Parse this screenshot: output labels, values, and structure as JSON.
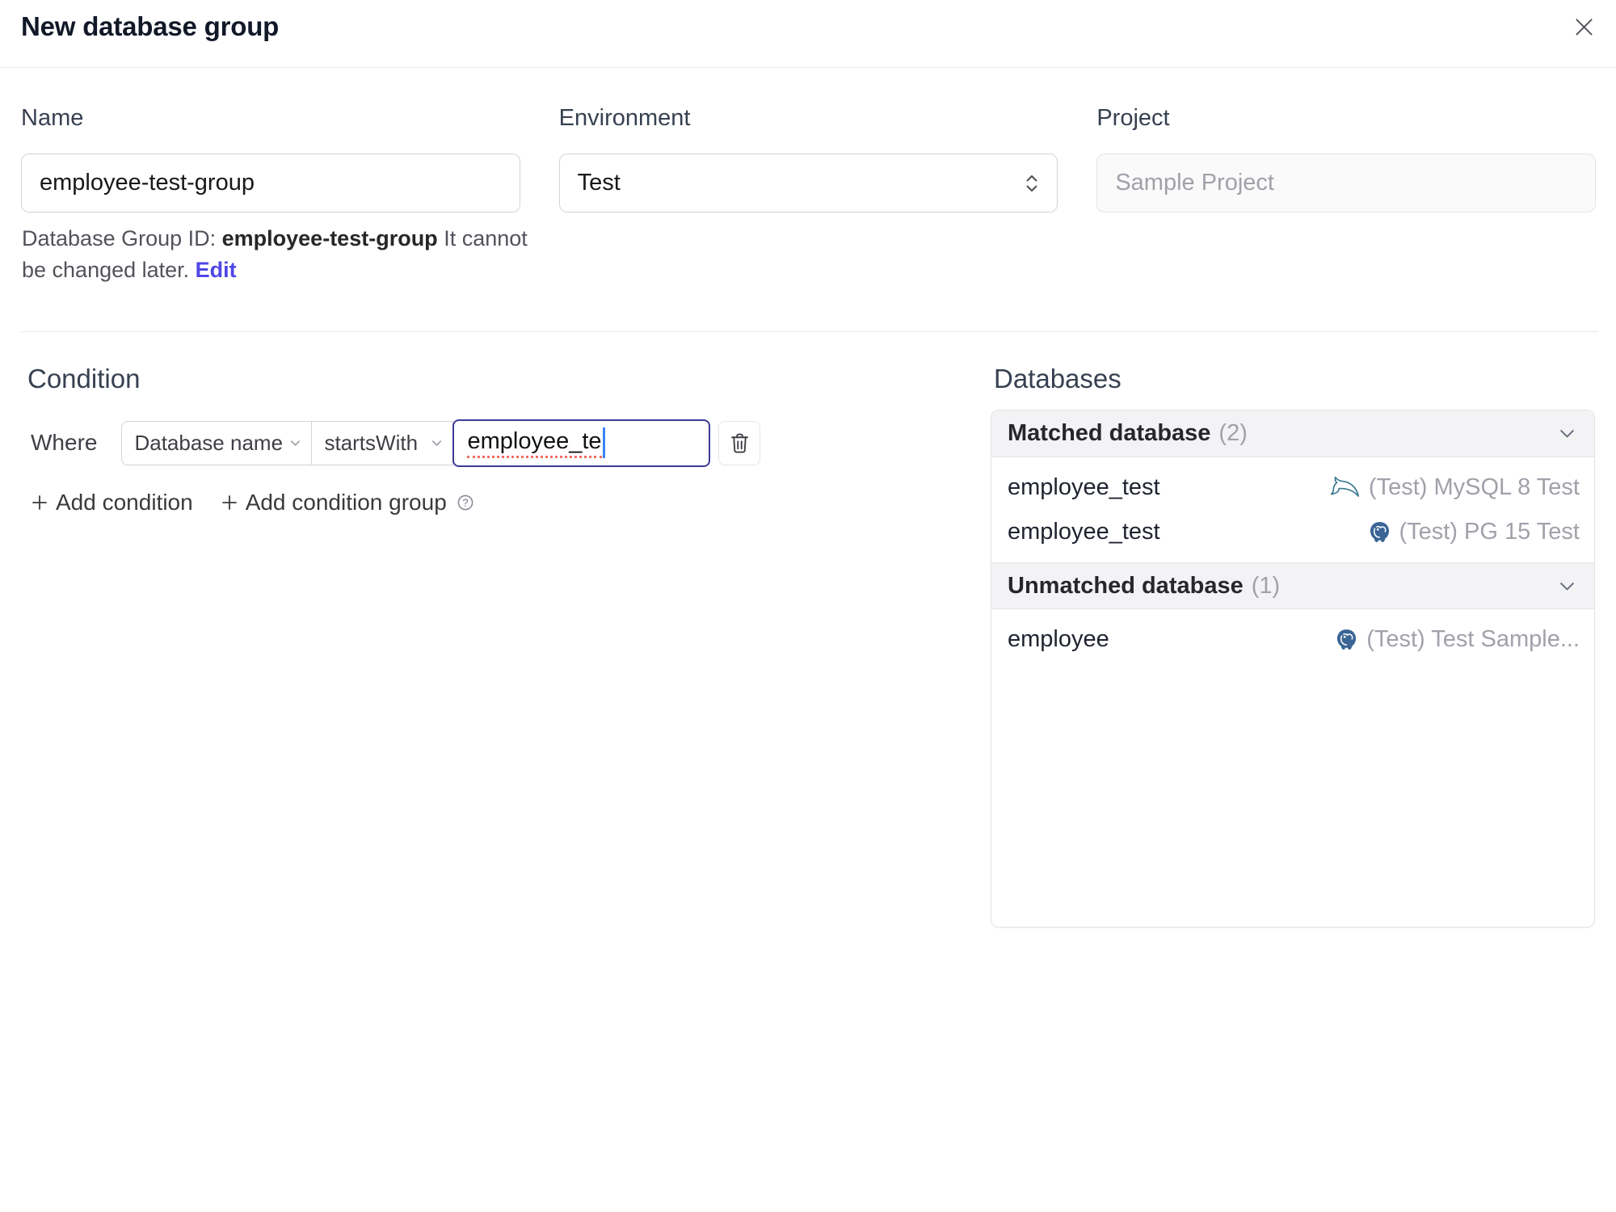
{
  "dialog": {
    "title": "New database group"
  },
  "form": {
    "name": {
      "label": "Name",
      "value": "employee-test-group"
    },
    "environment": {
      "label": "Environment",
      "value": "Test"
    },
    "project": {
      "label": "Project",
      "value": "Sample Project"
    },
    "id_note": {
      "prefix": "Database Group ID: ",
      "id": "employee-test-group",
      "suffix": " It cannot be changed later. ",
      "edit": "Edit"
    }
  },
  "condition": {
    "heading": "Condition",
    "where": "Where",
    "field": "Database name",
    "operator": "startsWith",
    "value": "employee_te",
    "add_condition": "Add condition",
    "add_condition_group": "Add condition group"
  },
  "databases": {
    "heading": "Databases",
    "sections": [
      {
        "title": "Matched database",
        "count": "(2)",
        "rows": [
          {
            "name": "employee_test",
            "engine": "mysql",
            "instance": "(Test) MySQL 8 Test"
          },
          {
            "name": "employee_test",
            "engine": "postgres",
            "instance": "(Test) PG 15 Test"
          }
        ]
      },
      {
        "title": "Unmatched database",
        "count": "(1)",
        "rows": [
          {
            "name": "employee",
            "engine": "postgres",
            "instance": "(Test) Test Sample..."
          }
        ]
      }
    ]
  },
  "colors": {
    "accent": "#4f46e5",
    "focus_border": "#3d3a99",
    "caret": "#3b82f6",
    "squiggle": "#ef6f61",
    "section_header_bg": "#f3f3f5",
    "muted_text": "#a1a1aa"
  }
}
